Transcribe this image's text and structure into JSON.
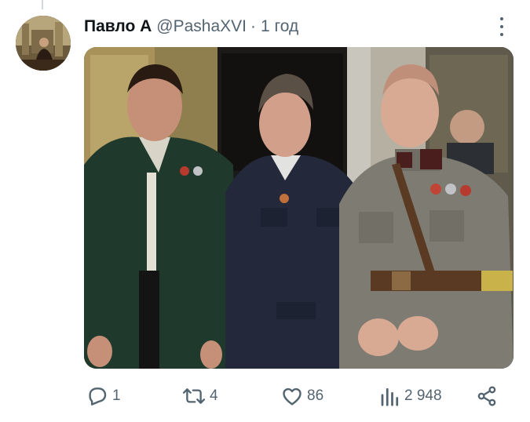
{
  "tweet": {
    "author_name": "Павло А",
    "handle": "@PashaXVI",
    "separator": "·",
    "time": "1 год"
  },
  "actions": {
    "replies": "1",
    "retweets": "4",
    "likes": "86",
    "views": "2 948"
  },
  "icons": {
    "more": "more-vertical-icon",
    "reply": "reply-icon",
    "retweet": "retweet-icon",
    "like": "heart-icon",
    "views": "views-chart-icon",
    "share": "share-icon"
  },
  "colors": {
    "text_primary": "#0f1419",
    "text_secondary": "#536471",
    "thread_line": "#cfd9de"
  }
}
